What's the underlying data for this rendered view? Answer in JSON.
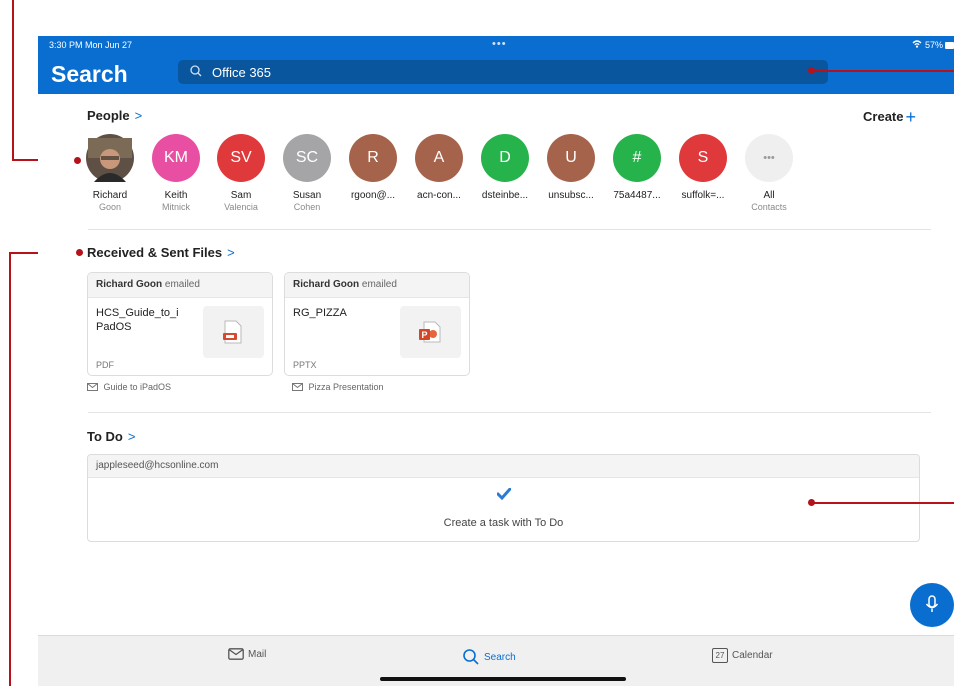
{
  "status": {
    "time": "3:30 PM  Mon Jun 27",
    "dots": "•••",
    "battery": "57%"
  },
  "header": {
    "title": "Search",
    "search_value": "Office 365"
  },
  "people": {
    "heading": "People",
    "chevron": ">",
    "create_label": "Create",
    "create_plus": "+",
    "items": [
      {
        "initials": "",
        "name1": "Richard",
        "name2": "Goon",
        "color": "#6b5a48"
      },
      {
        "initials": "KM",
        "name1": "Keith",
        "name2": "Mitnick",
        "color": "#e84fa3"
      },
      {
        "initials": "SV",
        "name1": "Sam",
        "name2": "Valencia",
        "color": "#e0393b"
      },
      {
        "initials": "SC",
        "name1": "Susan",
        "name2": "Cohen",
        "color": "#a5a5a7"
      },
      {
        "initials": "R",
        "name1": "rgoon@...",
        "name2": "",
        "color": "#a6634c"
      },
      {
        "initials": "A",
        "name1": "acn-con...",
        "name2": "",
        "color": "#a6634c"
      },
      {
        "initials": "D",
        "name1": "dsteinbe...",
        "name2": "",
        "color": "#27b34b"
      },
      {
        "initials": "U",
        "name1": "unsubsc...",
        "name2": "",
        "color": "#a6634c"
      },
      {
        "initials": "#",
        "name1": "75a4487...",
        "name2": "",
        "color": "#27b34b"
      },
      {
        "initials": "S",
        "name1": "suffolk=...",
        "name2": "",
        "color": "#e0393b"
      },
      {
        "initials": "•••",
        "name1": "All",
        "name2": "Contacts",
        "color": "#efefef"
      }
    ]
  },
  "files": {
    "heading": "Received & Sent Files",
    "chevron": ">",
    "items": [
      {
        "sender": "Richard Goon",
        "action": "emailed",
        "name": "HCS_Guide_to_i PadOS",
        "type": "PDF",
        "subject": "Guide to iPadOS",
        "icon": "pdf-file-icon"
      },
      {
        "sender": "Richard Goon",
        "action": "emailed",
        "name": "RG_PIZZA",
        "type": "PPTX",
        "subject": "Pizza Presentation",
        "icon": "powerpoint-file-icon"
      }
    ]
  },
  "todo": {
    "heading": "To Do",
    "chevron": ">",
    "account": "jappleseed@hcsonline.com",
    "action": "Create a task with To Do"
  },
  "tabs": [
    {
      "label": "Mail",
      "icon": "mail-icon"
    },
    {
      "label": "Search",
      "icon": "search-icon"
    },
    {
      "label": "Calendar",
      "icon": "calendar-icon",
      "date": "27"
    }
  ],
  "colors": {
    "accent": "#0a6ed1",
    "callout": "#b5121b"
  }
}
